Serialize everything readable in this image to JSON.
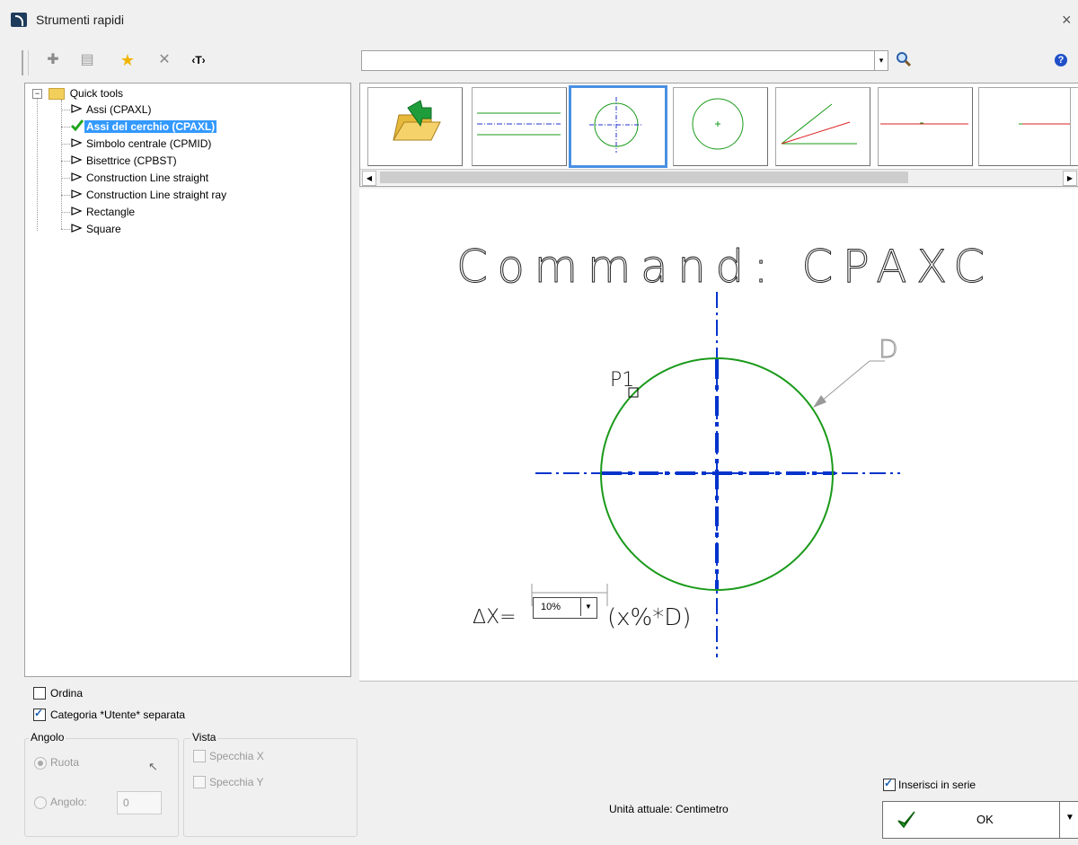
{
  "window": {
    "title": "Strumenti rapidi",
    "close_glyph": "×"
  },
  "toolbar": {
    "buttons": [
      {
        "name": "add-icon",
        "glyph": "✚"
      },
      {
        "name": "properties-icon",
        "glyph": "▤"
      },
      {
        "name": "star-icon",
        "glyph": "★"
      },
      {
        "name": "delete-icon",
        "glyph": "✕"
      },
      {
        "name": "text-icon",
        "glyph": "‹T›"
      }
    ]
  },
  "search": {
    "value": "",
    "dropdown_glyph": "▾",
    "search_icon": "magnifier"
  },
  "help_glyph": "?",
  "tree": {
    "root": "Quick tools",
    "items": [
      {
        "label": "Assi (CPAXL)",
        "selected": false
      },
      {
        "label": "Assi del cerchio (CPAXL)",
        "selected": true
      },
      {
        "label": "Simbolo centrale (CPMID)",
        "selected": false
      },
      {
        "label": "Bisettrice (CPBST)",
        "selected": false
      },
      {
        "label": "Construction Line straight",
        "selected": false
      },
      {
        "label": "Construction Line straight ray",
        "selected": false
      },
      {
        "label": "Rectangle",
        "selected": false
      },
      {
        "label": "Square",
        "selected": false
      }
    ]
  },
  "options": {
    "ordina": {
      "label": "Ordina",
      "checked": false
    },
    "categoria": {
      "label": "Categoria *Utente* separata",
      "checked": true
    }
  },
  "angolo": {
    "title": "Angolo",
    "ruota": {
      "label": "Ruota",
      "selected": true
    },
    "angolo": {
      "label": "Angolo:",
      "value": "0"
    }
  },
  "vista": {
    "title": "Vista",
    "specchia_x": {
      "label": "Specchia X",
      "checked": false
    },
    "specchia_y": {
      "label": "Specchia Y",
      "checked": false
    }
  },
  "preview": {
    "command_text": "Command:  CPAXC",
    "point_label": "P1",
    "diameter_label": "D",
    "delta_label": "∆X=",
    "percent_value": "10%",
    "formula": "(x%*D)"
  },
  "status": {
    "unit_text": "Unità attuale: Centimetro"
  },
  "inserisci": {
    "label": "Inserisci in serie",
    "checked": true
  },
  "ok_button": {
    "label": "OK"
  },
  "colors": {
    "selection": "#3399ff",
    "axis_blue": "#0033cc",
    "circle_green": "#1a9a1a",
    "thumb_selected": "#4a90e2"
  }
}
